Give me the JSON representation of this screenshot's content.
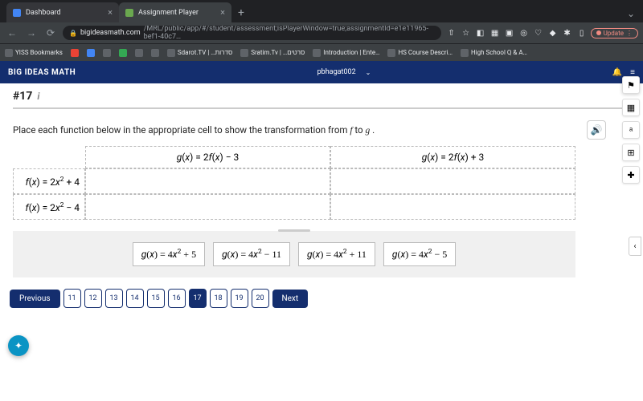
{
  "browser": {
    "tabs": [
      {
        "title": "Dashboard",
        "active": false
      },
      {
        "title": "Assignment Player",
        "active": true
      }
    ],
    "url_domain": "bigideasmath.com",
    "url_path": "/MRL/public/app/#/student/assessment;isPlayerWindow=true;assignmentId=e1e11965-bef1-40c7…",
    "update_label": "Update",
    "bookmarks": [
      "YISS Bookmarks",
      "M",
      "C",
      "",
      "",
      "",
      "",
      "Sdarot.TV | …סדרות",
      "Sratim.Tv | …סרטים",
      "Introduction | Ente…",
      "HS Course Descri…",
      "High School Q & A…"
    ]
  },
  "app": {
    "brand": "BIG IDEAS MATH",
    "user": "pbhagat002"
  },
  "question": {
    "number": "#17",
    "prompt_pre": "Place each function below in the appropriate cell to show the transformation from ",
    "prompt_var1": "f",
    "prompt_mid": " to ",
    "prompt_var2": "g",
    "prompt_post": " ."
  },
  "table": {
    "col1": "g(x) = 2f(x) − 3",
    "col2": "g(x) = 2f(x) + 3",
    "row1": "f(x) = 2x² + 4",
    "row2": "f(x) = 2x² − 4"
  },
  "options": [
    "g(x) = 4x² + 5",
    "g(x) = 4x² − 11",
    "g(x) = 4x² + 11",
    "g(x) = 4x² − 5"
  ],
  "nav": {
    "prev": "Previous",
    "next": "Next",
    "pages": [
      "11",
      "12",
      "13",
      "14",
      "15",
      "16",
      "17",
      "18",
      "19",
      "20"
    ],
    "current": "17"
  },
  "rail": {
    "flag": "⚑",
    "calc": "▦",
    "lang": "ᵃₐ",
    "help": "⊞",
    "access": "⇱"
  }
}
